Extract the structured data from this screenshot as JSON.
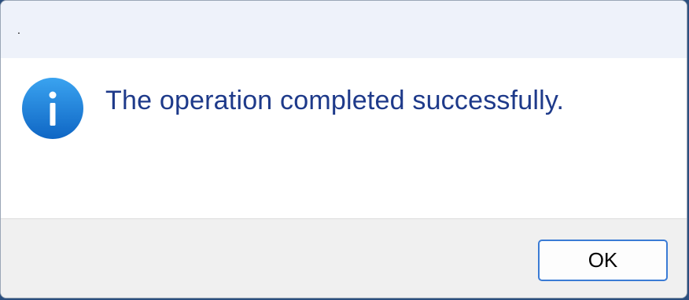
{
  "window": {
    "title": "."
  },
  "message": {
    "text": "The operation completed successfully.",
    "icon": "info-icon"
  },
  "buttons": {
    "ok_label": "OK"
  },
  "colors": {
    "icon_blue": "#1a7fd6",
    "message_text": "#1e3a8a",
    "button_border": "#3a7bd5",
    "titlebar_bg": "#eef2fa",
    "footer_bg": "#f0f0f0"
  }
}
